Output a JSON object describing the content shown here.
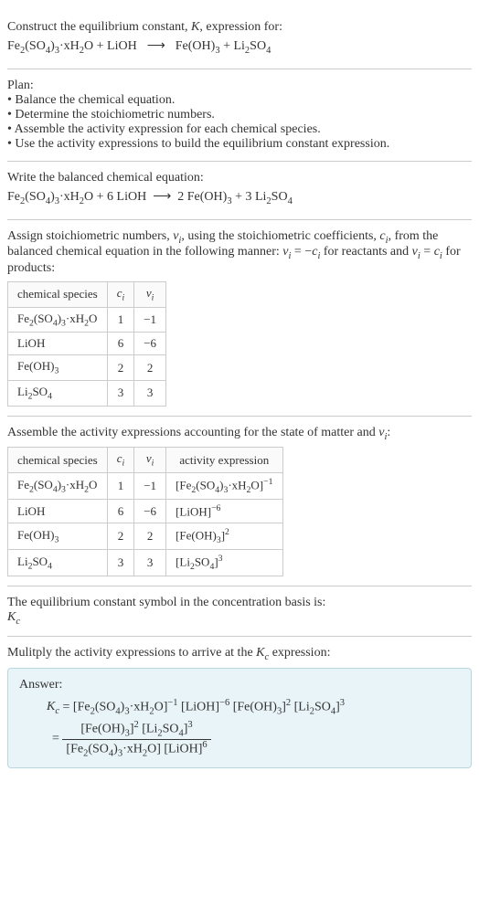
{
  "s1": {
    "title": "Construct the equilibrium constant, K, expression for:",
    "eq_lhs1": "Fe₂(SO₄)₃·xH₂O + LiOH",
    "arrow": "⟶",
    "eq_rhs1": "Fe(OH)₃ + Li₂SO₄"
  },
  "s2": {
    "title": "Plan:",
    "b1": "• Balance the chemical equation.",
    "b2": "• Determine the stoichiometric numbers.",
    "b3": "• Assemble the activity expression for each chemical species.",
    "b4": "• Use the activity expressions to build the equilibrium constant expression."
  },
  "s3": {
    "title": "Write the balanced chemical equation:",
    "eq": "Fe₂(SO₄)₃·xH₂O + 6 LiOH  ⟶  2 Fe(OH)₃ + 3 Li₂SO₄"
  },
  "s4": {
    "intro1": "Assign stoichiometric numbers, νᵢ, using the stoichiometric coefficients, cᵢ, from the balanced chemical equation in the following manner: νᵢ = −cᵢ for reactants and νᵢ = cᵢ for products:",
    "h1": "chemical species",
    "h2": "cᵢ",
    "h3": "νᵢ",
    "r1c1": "Fe₂(SO₄)₃·xH₂O",
    "r1c2": "1",
    "r1c3": "−1",
    "r2c1": "LiOH",
    "r2c2": "6",
    "r2c3": "−6",
    "r3c1": "Fe(OH)₃",
    "r3c2": "2",
    "r3c3": "2",
    "r4c1": "Li₂SO₄",
    "r4c2": "3",
    "r4c3": "3"
  },
  "s5": {
    "intro": "Assemble the activity expressions accounting for the state of matter and νᵢ:",
    "h1": "chemical species",
    "h2": "cᵢ",
    "h3": "νᵢ",
    "h4": "activity expression",
    "r1c1": "Fe₂(SO₄)₃·xH₂O",
    "r1c2": "1",
    "r1c3": "−1",
    "r1c4": "[Fe₂(SO₄)₃·xH₂O]⁻¹",
    "r2c1": "LiOH",
    "r2c2": "6",
    "r2c3": "−6",
    "r2c4": "[LiOH]⁻⁶",
    "r3c1": "Fe(OH)₃",
    "r3c2": "2",
    "r3c3": "2",
    "r3c4": "[Fe(OH)₃]²",
    "r4c1": "Li₂SO₄",
    "r4c2": "3",
    "r4c3": "3",
    "r4c4": "[Li₂SO₄]³"
  },
  "s6": {
    "l1": "The equilibrium constant symbol in the concentration basis is:",
    "l2": "K𝚌"
  },
  "s7": {
    "l1": "Mulitply the activity expressions to arrive at the K𝚌 expression:"
  },
  "ans": {
    "label": "Answer:",
    "line1": "K𝚌 = [Fe₂(SO₄)₃·xH₂O]⁻¹ [LiOH]⁻⁶ [Fe(OH)₃]² [Li₂SO₄]³",
    "frac_num": "[Fe(OH)₃]² [Li₂SO₄]³",
    "frac_den": "[Fe₂(SO₄)₃·xH₂O] [LiOH]⁶",
    "eq": "="
  }
}
